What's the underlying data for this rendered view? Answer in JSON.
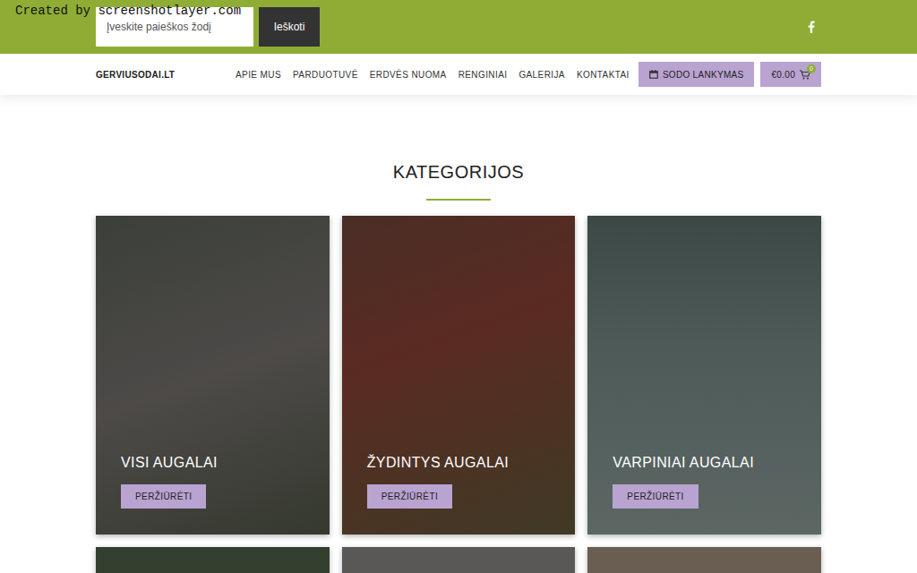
{
  "watermark": "Created by screenshotlayer.com",
  "topbar": {
    "search": {
      "placeholder": "Įveskite paieškos žodį"
    },
    "search_button": "Ieškoti"
  },
  "navbar": {
    "logo": "GERVIUSODAI.LT",
    "menu": [
      {
        "label": "APIE MUS",
        "selected": false
      },
      {
        "label": "PARDUOTUVĖ",
        "selected": false
      },
      {
        "label": "ERDVĖS NUOMA",
        "selected": false
      },
      {
        "label": "RENGINIAI",
        "selected": false
      },
      {
        "label": "GALERIJA",
        "selected": false
      },
      {
        "label": "KONTAKTAI",
        "selected": false
      }
    ],
    "visit_button": "SODO LANKYMAS",
    "cart": {
      "total": "€0.00",
      "count": "0"
    }
  },
  "section": {
    "title": "KATEGORIJOS"
  },
  "cards": [
    {
      "title": "VISI AUGALAI",
      "button": "PERŽIŪRĖTI"
    },
    {
      "title": "ŽYDINTYS AUGALAI",
      "button": "PERŽIŪRĖTI"
    },
    {
      "title": "VARPINIAI AUGALAI",
      "button": "PERŽIŪRĖTI"
    }
  ],
  "next_row_cards": 3
}
